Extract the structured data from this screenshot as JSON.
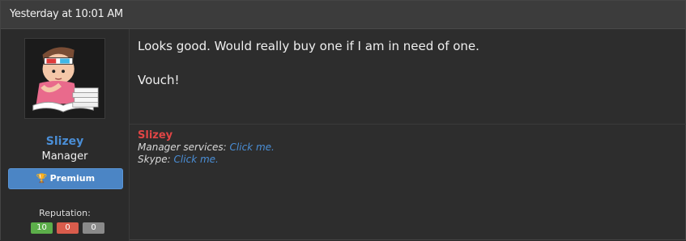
{
  "header": {
    "timestamp": "Yesterday at 10:01 AM"
  },
  "user": {
    "name": "Slizey",
    "role": "Manager",
    "badge_label": "Premium",
    "reputation_label": "Reputation:",
    "reputation": {
      "positive": "10",
      "negative": "0",
      "neutral": "0"
    }
  },
  "post": {
    "lines": [
      "Looks good. Would really buy one if I am in need of one.",
      "Vouch!"
    ]
  },
  "signature": {
    "name": "Slizey",
    "services_label": "Manager services:",
    "services_link": "Click me.",
    "skype_label": "Skype:",
    "skype_link": "Click me."
  },
  "colors": {
    "username": "#4a8ed6",
    "premium": "#4b85c5",
    "rep_positive": "#5cae4a",
    "rep_negative": "#d95c4c",
    "rep_neutral": "#8a8a8a",
    "signature_name": "#e04545"
  },
  "icons": {
    "badge": "trophy-icon",
    "avatar": "cartoon-reader-avatar"
  }
}
